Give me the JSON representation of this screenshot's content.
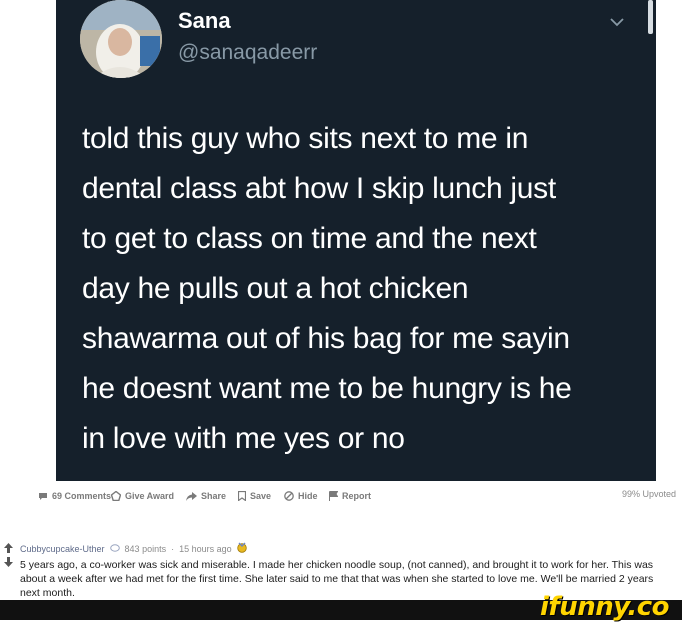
{
  "tweet": {
    "name": "Sana",
    "handle": "@sanaqadeerr",
    "lines": [
      "told this guy who sits next to me in",
      "dental class abt how I skip lunch just",
      "to get to class on time and the next",
      "day he pulls out a hot chicken",
      "shawarma out of his bag for me sayin",
      "he doesnt want me to be hungry is he",
      "in love with me yes or no"
    ]
  },
  "post_actions": {
    "comments": "69 Comments",
    "give_award": "Give Award",
    "share": "Share",
    "save": "Save",
    "hide": "Hide",
    "report": "Report",
    "upvoted": "99% Upvoted"
  },
  "comment": {
    "user": "Cubbycupcake-Uther",
    "points": "843 points",
    "separator": "·",
    "time": "15 hours ago",
    "body": "5 years ago, a co-worker was sick and miserable. I made her chicken noodle soup, (not canned), and brought it to work for her. This was about a week after we had met for the first time. She later said to me that that was when she started to love me. We'll be married 2 years next month."
  },
  "watermark": "ifunny.co",
  "colors": {
    "tweet_bg": "#15202b",
    "tweet_text": "#ffffff",
    "handle": "#8899a6",
    "logo": "#ffd400"
  }
}
